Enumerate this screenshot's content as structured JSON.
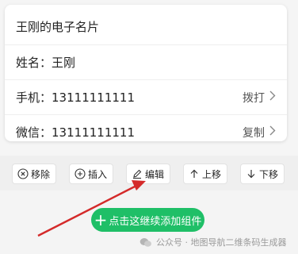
{
  "card": {
    "title": "王刚的电子名片",
    "name_row": {
      "label": "姓名：",
      "value": "王刚"
    },
    "phone_row": {
      "label": "手机：",
      "value": "13111111111",
      "action": "拨打"
    },
    "wechat_row": {
      "label": "微信：",
      "value": "13111111111",
      "action": "复制"
    }
  },
  "toolbar": {
    "remove": "移除",
    "insert": "插入",
    "edit": "编辑",
    "move_up": "上移",
    "move_down": "下移"
  },
  "add_component": {
    "label": "点击这继续添加组件"
  },
  "watermark": {
    "text": "公众号 · 地图导航二维条码生成器"
  },
  "colors": {
    "accent": "#1fbf67",
    "arrow": "#d42a2a"
  }
}
